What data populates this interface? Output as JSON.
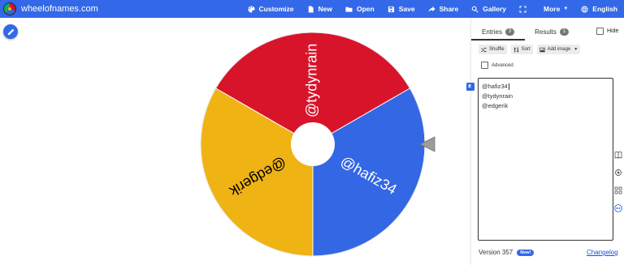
{
  "header": {
    "site_title": "wheelofnames.com",
    "nav": [
      {
        "label": "Customize",
        "icon": "palette-icon"
      },
      {
        "label": "New",
        "icon": "new-file-icon"
      },
      {
        "label": "Open",
        "icon": "folder-icon"
      },
      {
        "label": "Save",
        "icon": "save-icon"
      },
      {
        "label": "Share",
        "icon": "share-icon"
      },
      {
        "label": "Gallery",
        "icon": "search-icon"
      },
      {
        "label": "",
        "icon": "fullscreen-icon"
      },
      {
        "label": "More",
        "icon": "chevron-down-icon"
      },
      {
        "label": "English",
        "icon": "globe-icon"
      }
    ]
  },
  "wheel": {
    "segments": [
      {
        "label": "@tydynrain",
        "color": "#d8142b"
      },
      {
        "label": "@hafiz34",
        "color": "#3467e3"
      },
      {
        "label": "@edgerik",
        "color": "#efb314"
      }
    ]
  },
  "panel": {
    "tabs": {
      "entries": {
        "label": "Entries",
        "count": "3"
      },
      "results": {
        "label": "Results",
        "count": "1"
      }
    },
    "hide_label": "Hide",
    "tools": {
      "shuffle": "Shuffle",
      "sort": "Sort",
      "add_image": "Add image"
    },
    "advanced_label": "Advanced",
    "entries": [
      "@hafiz34",
      "@tydynrain",
      "@edgerik"
    ],
    "version": "Version 357",
    "new_badge": "New!",
    "changelog": "Changelog"
  },
  "colors": {
    "accent": "#3369e8",
    "red": "#d8142b",
    "blue": "#3467e3",
    "yellow": "#efb314"
  }
}
